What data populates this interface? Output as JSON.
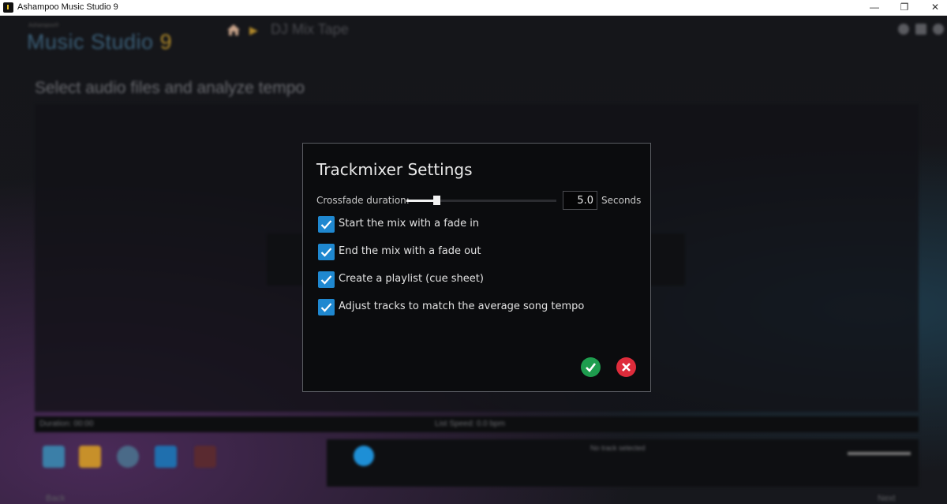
{
  "window": {
    "title": "Ashampoo Music Studio 9",
    "minimize_glyph": "—",
    "maximize_glyph": "❐",
    "close_glyph": "✕"
  },
  "background": {
    "brand_small": "Ashampoo®",
    "brand_name": "Music Studio",
    "brand_version": "9",
    "breadcrumb": "DJ Mix Tape",
    "heading": "Select audio files and analyze tempo",
    "status_duration": "Duration: 00:00",
    "status_speed": "List Speed: 0.0 bpm",
    "player_no_track": "No track selected",
    "back_label": "Back",
    "next_label": "Next"
  },
  "dialog": {
    "title": "Trackmixer Settings",
    "crossfade_label": "Crossfade duration:",
    "crossfade_value": "5.0",
    "crossfade_unit": "Seconds",
    "crossfade_fraction": 0.2,
    "options": [
      {
        "label": "Start the mix with a fade in",
        "checked": true
      },
      {
        "label": "End the mix with a fade out",
        "checked": true
      },
      {
        "label": "Create a playlist (cue sheet)",
        "checked": true
      },
      {
        "label": "Adjust tracks to match the average song tempo",
        "checked": true
      }
    ],
    "ok_icon": "check-icon",
    "cancel_icon": "x-icon"
  },
  "colors": {
    "accent": "#1f88d0",
    "ok": "#1e9d4e",
    "cancel": "#de2c3b"
  }
}
